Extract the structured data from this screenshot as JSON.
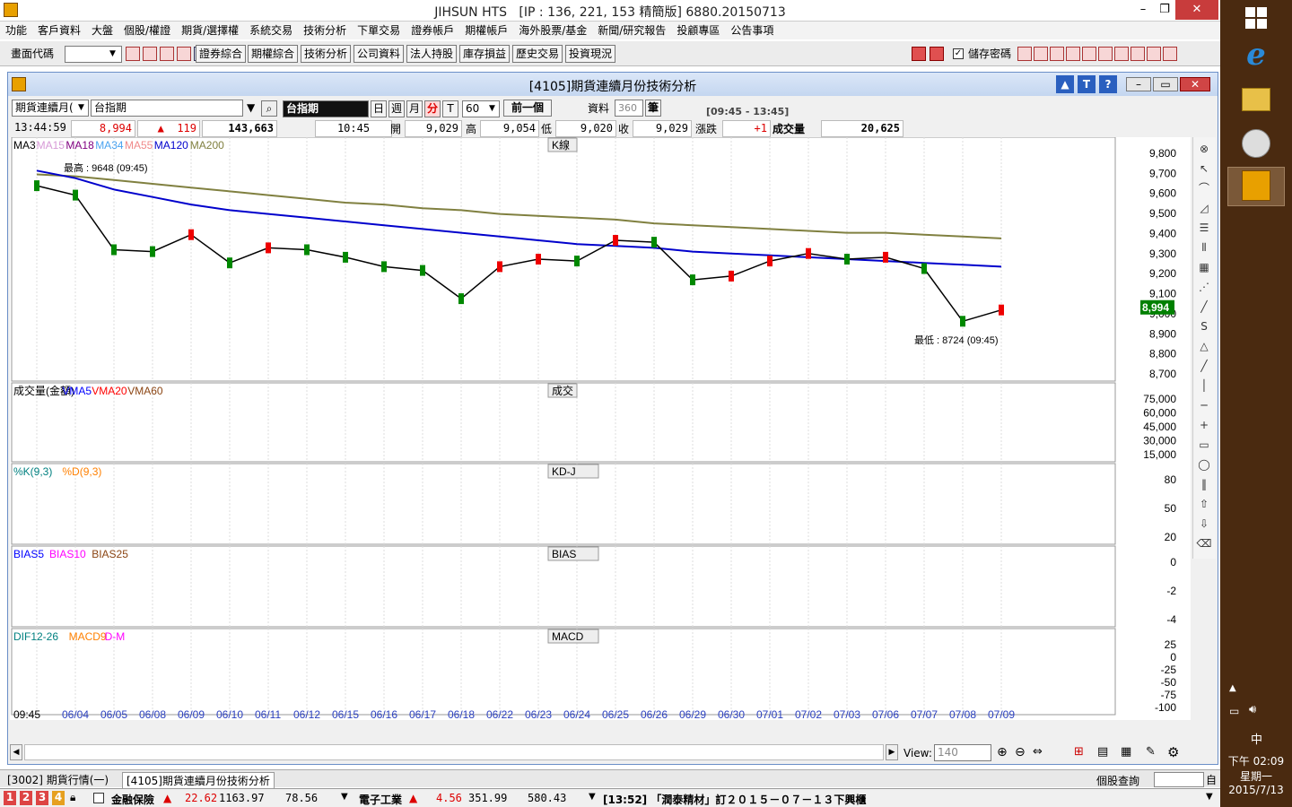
{
  "app": {
    "title": "JIHSUN HTS",
    "title_info": "[IP : 136, 221, 153 精簡版] 6880.20150713"
  },
  "menu": [
    "功能",
    "客戶資料",
    "大盤",
    "個股/權證",
    "期貨/選擇權",
    "系統交易",
    "技術分析",
    "下單交易",
    "證券帳戶",
    "期權帳戶",
    "海外股票/基金",
    "新聞/研究報告",
    "投顧專區",
    "公告事項"
  ],
  "toolbar": {
    "code_label": "畫面代碼",
    "buttons": [
      "證券綜合",
      "期權綜合",
      "技術分析",
      "公司資料",
      "法人持股",
      "庫存損益",
      "歷史交易",
      "投資現況"
    ],
    "save_password_label": "儲存密碼"
  },
  "window": {
    "title": "[4105]期貨連續月份技術分析",
    "product_type": "期貨連續月(",
    "product_name": "台指期",
    "product_selected": "台指期",
    "period_day": "日",
    "period_week": "週",
    "period_month": "月",
    "period_min": "分",
    "period_tick": "T",
    "interval": "60",
    "prev_label": "前一個",
    "data_label": "資料",
    "data_count": "360",
    "unit_label": "筆",
    "range_label": "[09:45 - 13:45]"
  },
  "quote": {
    "time": "13:44:59",
    "price": "8,994",
    "change": "119",
    "volume_total": "143,663",
    "bar_time": "10:45",
    "open_label": "開",
    "open": "9,029",
    "high_label": "高",
    "high": "9,054",
    "low_label": "低",
    "low": "9,020",
    "close_label": "收",
    "close": "9,029",
    "chg_label": "漲跌",
    "chg": "+1",
    "vol_label": "成交量",
    "vol": "20,625"
  },
  "panels": {
    "kline": {
      "tag": "K線",
      "legend": [
        {
          "name": "MA3",
          "color": "#000000"
        },
        {
          "name": "MA15",
          "color": "#d79ad7"
        },
        {
          "name": "MA18",
          "color": "#800080"
        },
        {
          "name": "MA34",
          "color": "#4aa3f0"
        },
        {
          "name": "MA55",
          "color": "#f08a8a"
        },
        {
          "name": "MA120",
          "color": "#0000cc"
        },
        {
          "name": "MA200",
          "color": "#808040"
        }
      ],
      "high_note": "最高 : 9648 (09:45)",
      "low_note": "最低 : 8724 (09:45)",
      "last_price": "8,994",
      "yticks": [
        "9,800",
        "9,700",
        "9,600",
        "9,500",
        "9,400",
        "9,300",
        "9,200",
        "9,100",
        "9,000",
        "8,900",
        "8,800",
        "8,700"
      ]
    },
    "volume": {
      "tag": "成交",
      "legend": [
        {
          "name": "成交量(金額)",
          "color": "#000000"
        },
        {
          "name": "VMA5",
          "color": "#0000ff"
        },
        {
          "name": "VMA20",
          "color": "#ff0000"
        },
        {
          "name": "VMA60",
          "color": "#8b4513"
        }
      ],
      "yticks": [
        "75,000",
        "60,000",
        "45,000",
        "30,000",
        "15,000"
      ]
    },
    "kd": {
      "tag": "KD-J",
      "legend": [
        {
          "name": "%K(9,3)",
          "color": "#008080"
        },
        {
          "name": "%D(9,3)",
          "color": "#ff8000"
        }
      ],
      "yticks": [
        "80",
        "50",
        "20"
      ]
    },
    "bias": {
      "tag": "BIAS",
      "legend": [
        {
          "name": "BIAS5",
          "color": "#0000ff"
        },
        {
          "name": "BIAS10",
          "color": "#ff00ff"
        },
        {
          "name": "BIAS25",
          "color": "#8b4513"
        }
      ],
      "yticks": [
        "0",
        "-2",
        "-4"
      ]
    },
    "macd": {
      "tag": "MACD",
      "legend": [
        {
          "name": "DIF12-26",
          "color": "#008080"
        },
        {
          "name": "MACD9",
          "color": "#ff8000"
        },
        {
          "name": "D-M",
          "color": "#ff00ff"
        }
      ],
      "yticks": [
        "25",
        "0",
        "-25",
        "-50",
        "-75",
        "-100"
      ]
    }
  },
  "xaxis": [
    "09:45",
    "06/04",
    "06/05",
    "06/08",
    "06/09",
    "06/10",
    "06/11",
    "06/12",
    "06/15",
    "06/16",
    "06/17",
    "06/18",
    "06/22",
    "06/23",
    "06/24",
    "06/25",
    "06/26",
    "06/29",
    "06/30",
    "07/01",
    "07/02",
    "07/03",
    "07/06",
    "07/07",
    "07/08",
    "07/09"
  ],
  "view": {
    "label": "View:",
    "value": "140"
  },
  "tabs": [
    "[3002] 期貨行情(一)",
    "[4105]期貨連續月份技術分析"
  ],
  "status_right": "個股查詢",
  "ticker": {
    "nums": [
      "1",
      "2",
      "3",
      "4"
    ],
    "item1_name": "金融保險",
    "item1_chg": "22.62",
    "item1_idx": "1163.97",
    "item1_vol": "78.56",
    "item2_name": "電子工業",
    "item2_chg": "4.56",
    "item2_idx": "351.99",
    "item2_vol": "580.43",
    "news": "[13:52] 「潤泰精材」訂２０１５－０７－１３下興櫃"
  },
  "clock": {
    "time": "下午 02:09",
    "day": "星期一",
    "date": "2015/7/13",
    "ime": "中"
  },
  "chart_data": {
    "type": "line",
    "note_text": "",
    "x": [
      "09:45",
      "06/04",
      "06/05",
      "06/08",
      "06/09",
      "06/10",
      "06/11",
      "06/12",
      "06/15",
      "06/16",
      "06/17",
      "06/18",
      "06/22",
      "06/23",
      "06/24",
      "06/25",
      "06/26",
      "06/29",
      "06/30",
      "07/01",
      "07/02",
      "07/03",
      "07/06",
      "07/07",
      "07/08",
      "07/09"
    ],
    "close_series": [
      9640,
      9590,
      9300,
      9290,
      9380,
      9230,
      9310,
      9300,
      9260,
      9210,
      9190,
      9040,
      9210,
      9250,
      9240,
      9350,
      9340,
      9140,
      9160,
      9240,
      9280,
      9250,
      9260,
      9200,
      8920,
      8980
    ],
    "ma120": [
      9720,
      9680,
      9620,
      9580,
      9540,
      9510,
      9490,
      9470,
      9450,
      9430,
      9410,
      9390,
      9370,
      9350,
      9330,
      9320,
      9310,
      9290,
      9280,
      9270,
      9260,
      9250,
      9240,
      9230,
      9220,
      9210
    ],
    "ma200": [
      9700,
      9690,
      9670,
      9650,
      9630,
      9610,
      9590,
      9570,
      9550,
      9540,
      9520,
      9510,
      9490,
      9480,
      9470,
      9460,
      9440,
      9430,
      9420,
      9410,
      9400,
      9390,
      9390,
      9380,
      9370,
      9360
    ],
    "ylim": [
      8650,
      9850
    ]
  }
}
